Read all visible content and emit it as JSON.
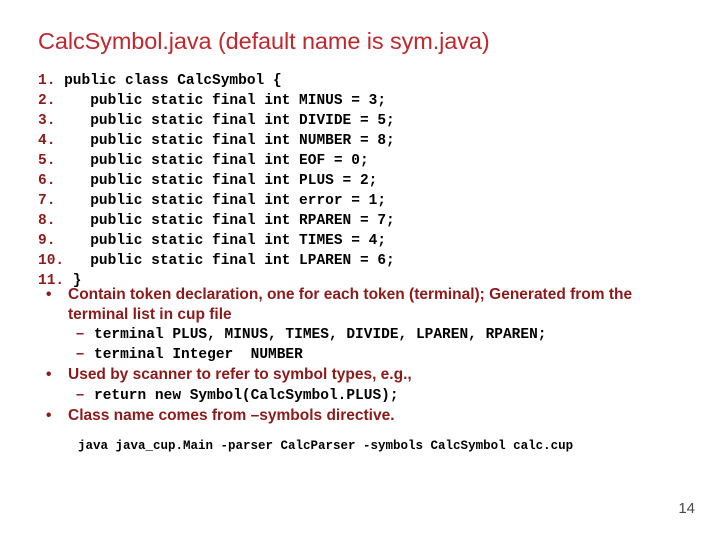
{
  "slide": {
    "title": "CalcSymbol.java (default name is sym.java)",
    "title_color": "#C0282D",
    "body_color": "#8C1A1A",
    "code_color": "#000000",
    "background": "#ffffff",
    "page_number": "14"
  },
  "code": {
    "lines": [
      {
        "no": "1.",
        "text": " public class CalcSymbol {"
      },
      {
        "no": "2.",
        "text": "    public static final int MINUS = 3;"
      },
      {
        "no": "3.",
        "text": "    public static final int DIVIDE = 5;"
      },
      {
        "no": "4.",
        "text": "    public static final int NUMBER = 8;"
      },
      {
        "no": "5.",
        "text": "    public static final int EOF = 0;"
      },
      {
        "no": "6.",
        "text": "    public static final int PLUS = 2;"
      },
      {
        "no": "7.",
        "text": "    public static final int error = 1;"
      },
      {
        "no": "8.",
        "text": "    public static final int RPAREN = 7;"
      },
      {
        "no": "9.",
        "text": "    public static final int TIMES = 4;"
      },
      {
        "no": "10.",
        "text": "   public static final int LPAREN = 6;"
      },
      {
        "no": "11.",
        "text": " }"
      }
    ]
  },
  "bullets": [
    {
      "level": 1,
      "marker": "•",
      "text": "Contain token declaration, one for each token (terminal); Generated from the terminal list in cup file"
    },
    {
      "level": 2,
      "marker": "–",
      "text": "terminal PLUS, MINUS, TIMES, DIVIDE, LPAREN, RPAREN;"
    },
    {
      "level": 2,
      "marker": "–",
      "text": "terminal Integer  NUMBER"
    },
    {
      "level": 1,
      "marker": "•",
      "text": "Used by scanner to refer to symbol types, e.g.,"
    },
    {
      "level": 2,
      "marker": "–",
      "text": "return new Symbol(CalcSymbol.PLUS);"
    },
    {
      "level": 1,
      "marker": "•",
      "text": "Class name comes from –symbols directive."
    }
  ],
  "command": {
    "text": "java java_cup.Main -parser CalcParser -symbols CalcSymbol calc.cup"
  }
}
